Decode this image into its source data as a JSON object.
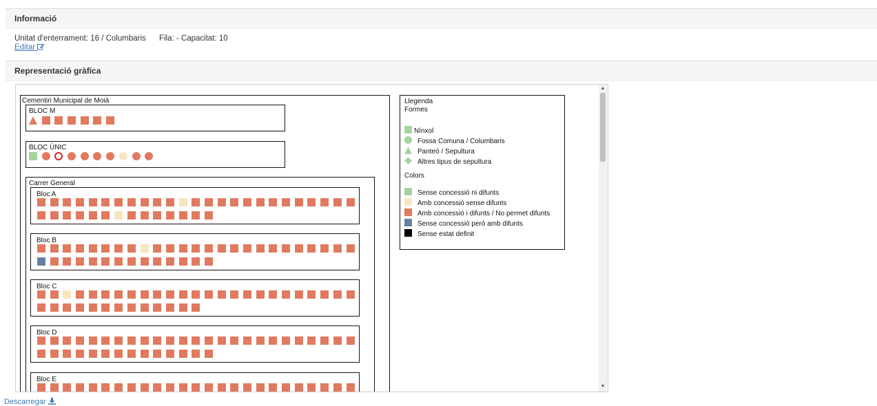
{
  "info": {
    "title": "Informació",
    "unit_label": "Unitat d'enterrament: 16 / Columbaris",
    "row_capacity": "Fila: - Capacitat: 10",
    "edit_label": "Editar"
  },
  "representation": {
    "title": "Representació gràfica",
    "cemetery_name": "Cementiri Municipal de Moià",
    "blocks": [
      {
        "name": "BLOC M",
        "rows": [
          [
            "tri:amb",
            "sq:amb",
            "sq:amb",
            "sq:amb",
            "sq:amb",
            "sq:amb",
            "sq:amb"
          ]
        ]
      },
      {
        "name": "BLOC ÚNIC",
        "rows": [
          [
            "sq:sense",
            "ci:amb",
            "ci:selected",
            "ci:amb",
            "ci:amb",
            "ci:amb",
            "ci:amb",
            "ci:sensedif",
            "ci:amb",
            "ci:amb"
          ]
        ]
      }
    ],
    "street": {
      "name": "Carrer General",
      "blocs": [
        {
          "name": "Bloc A",
          "row1": 25,
          "row2": 14,
          "row1_sense_dif": [
            11
          ],
          "row2_sense_dif": [
            6
          ],
          "row1_sense_amb": [],
          "row2_sense_amb": []
        },
        {
          "name": "Bloc B",
          "row1": 25,
          "row2": 14,
          "row1_sense_dif": [
            8
          ],
          "row2_sense_dif": [],
          "row1_sense_amb": [],
          "row2_sense_amb": [
            0
          ]
        },
        {
          "name": "Bloc C",
          "row1": 25,
          "row2": 13,
          "row1_sense_dif": [
            2
          ],
          "row2_sense_dif": [],
          "row1_sense_amb": [],
          "row2_sense_amb": []
        },
        {
          "name": "Bloc D",
          "row1": 25,
          "row2": 14,
          "row1_sense_dif": [],
          "row2_sense_dif": [],
          "row1_sense_amb": [],
          "row2_sense_amb": []
        },
        {
          "name": "Bloc E",
          "row1": 25,
          "row2": 0,
          "row1_sense_dif": [],
          "row2_sense_dif": [],
          "row1_sense_amb": [],
          "row2_sense_amb": []
        }
      ]
    },
    "legend": {
      "title": "Llegenda",
      "forms_title": "Formes",
      "forms": [
        {
          "shape": "square",
          "label": "Nínxol"
        },
        {
          "shape": "circle",
          "label": "Fossa Comuna / Columbaris"
        },
        {
          "shape": "triangle",
          "label": "Panteó / Sepultura"
        },
        {
          "shape": "diamond",
          "label": "Altres tipus de sepultura"
        }
      ],
      "colors_title": "Colors",
      "colors": [
        {
          "color": "#a7d3a0",
          "label": "Sense concessió ni difunts"
        },
        {
          "color": "#f6e6c0",
          "label": "Amb concessió sense difunts"
        },
        {
          "color": "#e07a5f",
          "label": "Amb concessió i difunts / No permet difunts"
        },
        {
          "color": "#6383a0",
          "label": "Sense concessió però amb difunts"
        },
        {
          "color": "#000000",
          "label": "Sense estat definit"
        }
      ]
    }
  },
  "download_label": "Descarregar",
  "colors": {
    "amb": "#e07a5f",
    "sense": "#a7d3a0",
    "sensedif": "#f6e6c0",
    "sense_amb": "#6383a0",
    "selected_border": "#d62020",
    "form_shape": "#a7d3a0"
  }
}
